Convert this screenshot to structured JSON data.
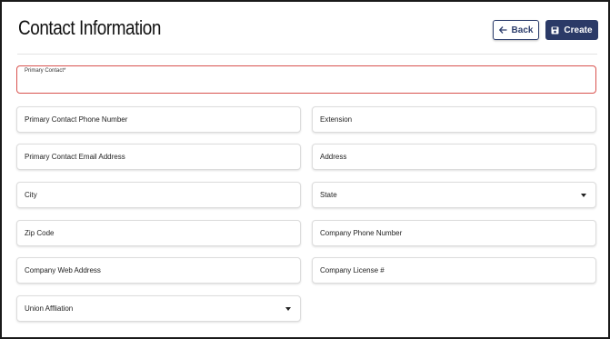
{
  "page": {
    "title": "Contact Information"
  },
  "toolbar": {
    "back_label": "Back",
    "create_label": "Create"
  },
  "form": {
    "primary_contact": {
      "label": "Primary Contact*",
      "value": ""
    },
    "primary_phone": {
      "placeholder": "Primary Contact Phone Number"
    },
    "extension": {
      "placeholder": "Extension"
    },
    "primary_email": {
      "placeholder": "Primary Contact Email Address"
    },
    "address": {
      "placeholder": "Address"
    },
    "city": {
      "placeholder": "City"
    },
    "state": {
      "placeholder": "State"
    },
    "zip": {
      "placeholder": "Zip Code"
    },
    "company_phone": {
      "placeholder": "Company Phone Number"
    },
    "company_web": {
      "placeholder": "Company Web Address"
    },
    "company_license": {
      "placeholder": "Company License #"
    },
    "union": {
      "placeholder": "Union Affliation"
    }
  },
  "colors": {
    "brand_navy": "#2b3a67",
    "error_red": "#d9534f"
  },
  "icons": {
    "back": "arrow-left-icon",
    "create": "save-icon",
    "dropdown": "caret-down-icon"
  }
}
